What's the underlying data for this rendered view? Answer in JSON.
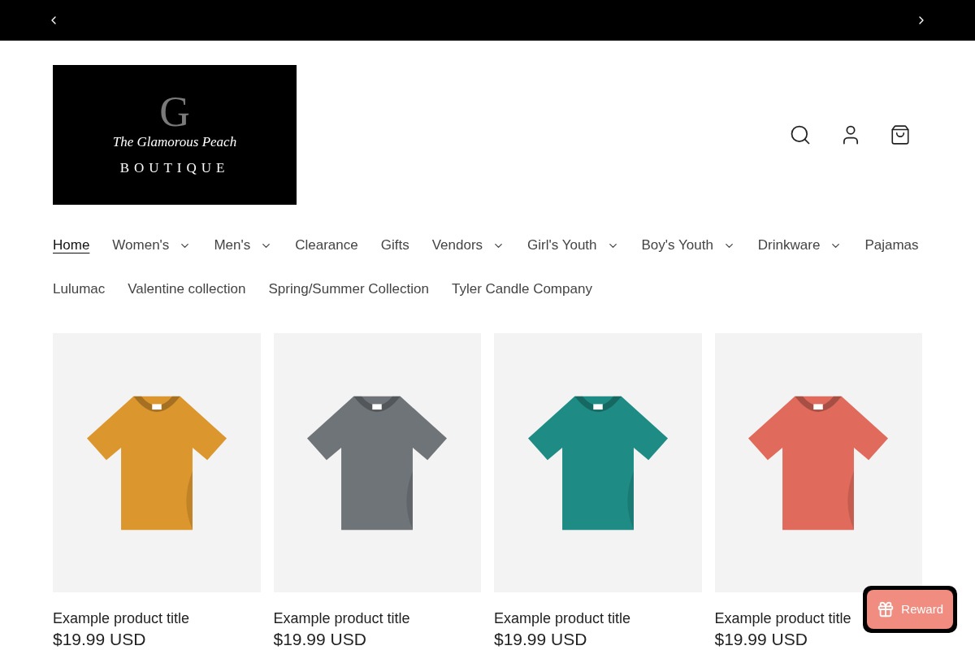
{
  "logo": {
    "monogram": "G",
    "script": "The Glamorous Peach",
    "word": "BOUTIQUE"
  },
  "nav": [
    {
      "label": "Home",
      "selected": true,
      "dropdown": false
    },
    {
      "label": "Women's",
      "selected": false,
      "dropdown": true
    },
    {
      "label": "Men's",
      "selected": false,
      "dropdown": true
    },
    {
      "label": "Clearance",
      "selected": false,
      "dropdown": false
    },
    {
      "label": "Gifts",
      "selected": false,
      "dropdown": false
    },
    {
      "label": "Vendors",
      "selected": false,
      "dropdown": true
    },
    {
      "label": "Girl's Youth",
      "selected": false,
      "dropdown": true
    },
    {
      "label": "Boy's Youth",
      "selected": false,
      "dropdown": true
    },
    {
      "label": "Drinkware",
      "selected": false,
      "dropdown": true
    },
    {
      "label": "Pajamas",
      "selected": false,
      "dropdown": false
    },
    {
      "label": "Lulumac",
      "selected": false,
      "dropdown": false
    },
    {
      "label": "Valentine collection",
      "selected": false,
      "dropdown": false
    },
    {
      "label": "Spring/Summer Collection",
      "selected": false,
      "dropdown": false
    },
    {
      "label": "Tyler Candle Company",
      "selected": false,
      "dropdown": false
    }
  ],
  "products": [
    {
      "title": "Example product title",
      "price": "$19.99 USD",
      "color": "#dc962e"
    },
    {
      "title": "Example product title",
      "price": "$19.99 USD",
      "color": "#6f7479"
    },
    {
      "title": "Example product title",
      "price": "$19.99 USD",
      "color": "#1e8c84"
    },
    {
      "title": "Example product title",
      "price": "$19.99 USD",
      "color": "#e06a5c"
    }
  ],
  "reward": {
    "label": "Reward"
  }
}
